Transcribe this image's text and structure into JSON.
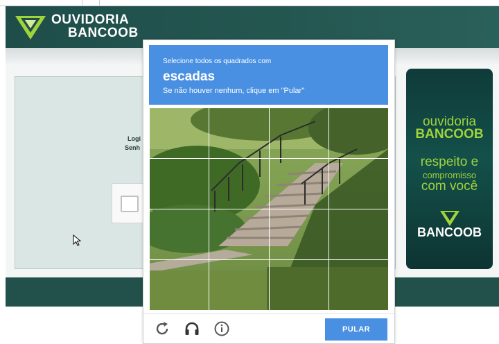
{
  "header": {
    "brand_line1": "OUVIDORIA",
    "brand_line2": "BANCOOB",
    "logo_icon": "bancoob-triangle-logo-icon",
    "bg_color": "#245650"
  },
  "login": {
    "login_label": "Logi",
    "password_label": "Senh"
  },
  "ad_banner": {
    "line1": "ouvidoria",
    "line2": "BANCOOB",
    "line3": "respeito e",
    "line4": "compromisso",
    "line5": "com você",
    "line6": "BANCOOB",
    "accent_color": "#9fd43b"
  },
  "captcha": {
    "instruction": "Selecione todos os quadrados com",
    "target": "escadas",
    "sub": "Se não houver nenhum, clique em \"Pular\"",
    "skip_label": "PULAR",
    "icons": [
      "reload-icon",
      "headphones-icon",
      "info-icon"
    ],
    "grid": {
      "rows": 4,
      "cols": 4
    },
    "accent_color": "#4a90e2"
  }
}
